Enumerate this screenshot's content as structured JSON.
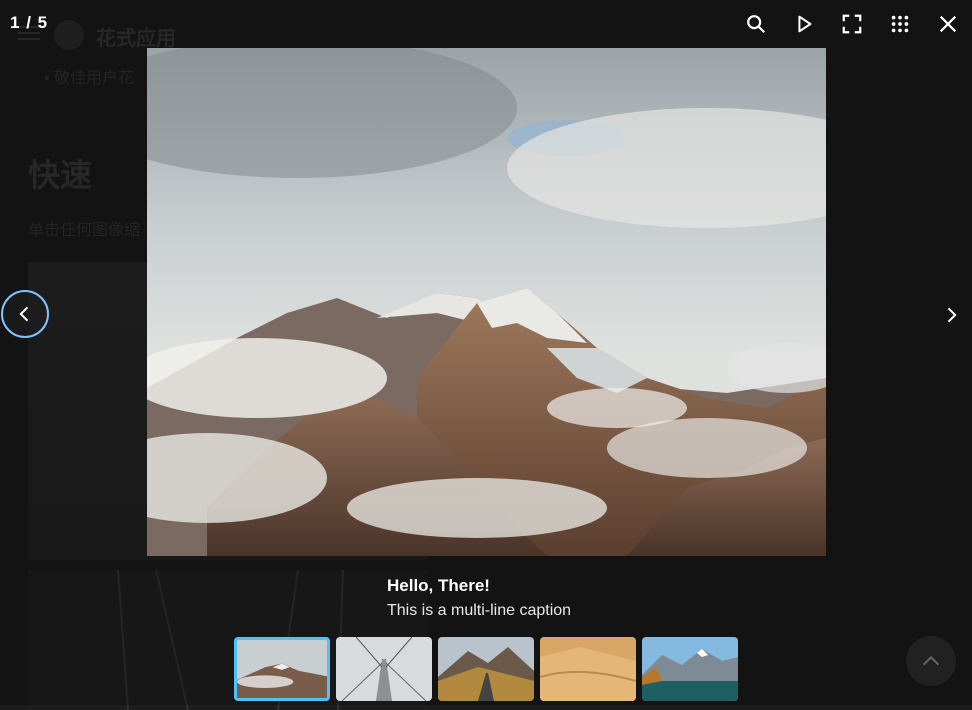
{
  "background_page": {
    "brand": "花式应用",
    "bullet_text": "敬佳用户花",
    "heading": "快速",
    "paragraph": "单击任何图像缩"
  },
  "lightbox": {
    "counter_current": "1",
    "counter_separator": "/",
    "counter_total": "5",
    "toolbar": [
      {
        "icon": "zoom-icon"
      },
      {
        "icon": "play-icon"
      },
      {
        "icon": "fullscreen-icon"
      },
      {
        "icon": "grid-icon"
      },
      {
        "icon": "close-icon"
      }
    ],
    "caption_title": "Hello, There!",
    "caption_subtitle": "This is a multi-line caption",
    "thumbnails": [
      {
        "name": "cloudy-mountains",
        "active": true
      },
      {
        "name": "misty-bridge",
        "active": false
      },
      {
        "name": "mountain-road",
        "active": false
      },
      {
        "name": "desert-dunes",
        "active": false
      },
      {
        "name": "lake-mountains",
        "active": false
      }
    ],
    "accent_color": "#4fc3f7"
  }
}
